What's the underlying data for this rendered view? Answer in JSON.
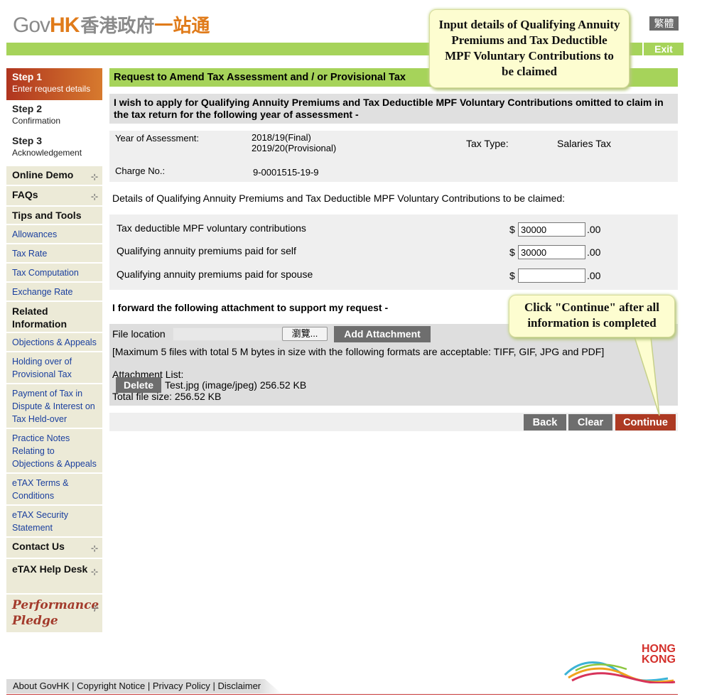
{
  "header": {
    "logo_gov": "Gov",
    "logo_hk": "HK",
    "logo_zh": "香港政府",
    "logo_zh2": "一站通",
    "lang_button": "繁體",
    "exit_button": "Exit"
  },
  "sidebar": {
    "steps": [
      {
        "title": "Step 1",
        "sub": "Enter request details"
      },
      {
        "title": "Step 2",
        "sub": "Confirmation"
      },
      {
        "title": "Step 3",
        "sub": "Acknowledgement"
      }
    ],
    "items": [
      {
        "label": "Online Demo"
      },
      {
        "label": "FAQs"
      },
      {
        "label": "Tips and Tools"
      },
      {
        "label": "Allowances"
      },
      {
        "label": "Tax Rate"
      },
      {
        "label": "Tax Computation"
      },
      {
        "label": "Exchange Rate"
      },
      {
        "label": "Related Information"
      },
      {
        "label": "Objections & Appeals"
      },
      {
        "label": "Holding over of Provisional Tax"
      },
      {
        "label": "Payment of Tax in Dispute & Interest on Tax Held-over"
      },
      {
        "label": "Practice Notes Relating to Objections & Appeals"
      },
      {
        "label": "eTAX Terms & Conditions"
      },
      {
        "label": "eTAX Security Statement"
      },
      {
        "label": "Contact Us"
      },
      {
        "label": "eTAX Help Desk"
      },
      {
        "label": "Performance Pledge"
      }
    ]
  },
  "main": {
    "title": "Request to Amend Tax Assessment and / or Provisional Tax",
    "intro": "I wish to apply for Qualifying Annuity Premiums and Tax Deductible MPF Voluntary Contributions omitted to claim in the tax return for the following year of assessment -",
    "info": {
      "yoa_label": "Year of Assessment:",
      "yoa_line1": "2018/19(Final)",
      "yoa_line2": "2019/20(Provisional)",
      "tax_type_label": "Tax Type:",
      "tax_type_value": "Salaries Tax",
      "charge_label": "Charge No.:",
      "charge_value": "9-0001515-19-9"
    },
    "details_line": "Details of Qualifying Annuity Premiums and Tax Deductible MPF Voluntary Contributions to be claimed:",
    "amounts": [
      {
        "label": "Tax deductible MPF voluntary contributions",
        "currency": "$",
        "value": "30000",
        "cents": ".00"
      },
      {
        "label": "Qualifying annuity premiums paid for self",
        "currency": "$",
        "value": "30000",
        "cents": ".00"
      },
      {
        "label": "Qualifying annuity premiums paid for spouse",
        "currency": "$",
        "value": "",
        "cents": ".00"
      }
    ],
    "attachment": {
      "heading": "I forward the following attachment to support my request -",
      "file_location_label": "File location",
      "browse_label": "瀏覽...",
      "add_label": "Add Attachment",
      "max_note": "[Maximum 5 files with total 5 M bytes in size with the following formats are acceptable: TIFF, GIF, JPG and PDF]",
      "list_label": "Attachment List:",
      "delete_label": "Delete",
      "file_entry": "Test.jpg (image/jpeg) 256.52 KB",
      "total_size": "Total file size: 256.52 KB"
    },
    "buttons": {
      "back": "Back",
      "clear": "Clear",
      "continue": "Continue"
    }
  },
  "callouts": {
    "top": "Input details of Qualifying Annuity Premiums and Tax Deductible MPF Voluntary Contributions to be claimed",
    "bottom": "Click \"Continue\" after all information is completed"
  },
  "footer": {
    "about": "About GovHK",
    "copyright": "Copyright Notice",
    "privacy": "Privacy Policy",
    "disclaimer": "Disclaimer",
    "sep": "|",
    "brand_line1": "HONG",
    "brand_line2": "KONG"
  },
  "colors": {
    "accent_green": "#a6d35a",
    "step_active": "#b0351f",
    "continue_red": "#ad3a23",
    "sidebar_bg": "#ecead7",
    "link_blue": "#1a3f9e"
  }
}
